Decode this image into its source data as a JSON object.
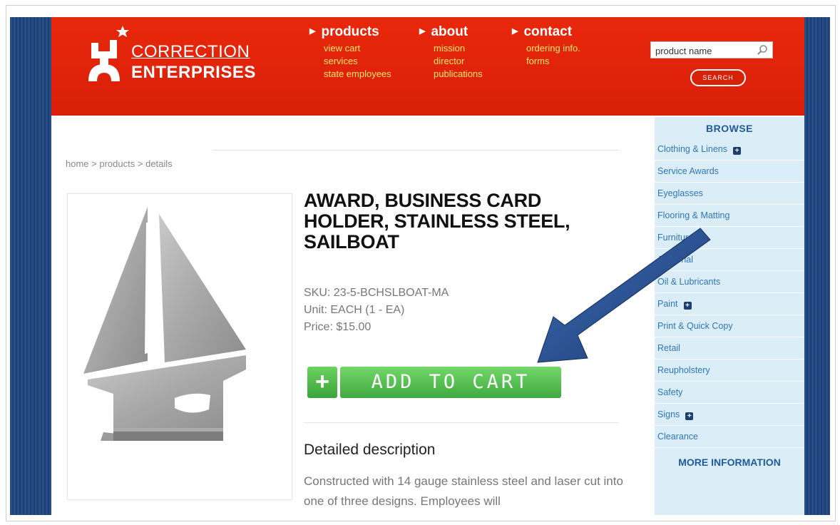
{
  "brand": {
    "line1": "CORRECTION",
    "line2": "ENTERPRISES"
  },
  "nav": [
    {
      "label": "products",
      "links": [
        "view cart",
        "services",
        "state employees"
      ]
    },
    {
      "label": "about",
      "links": [
        "mission",
        "director",
        "publications"
      ]
    },
    {
      "label": "contact",
      "links": [
        "ordering info.",
        "forms"
      ]
    }
  ],
  "search": {
    "value": "product name",
    "button_label": "SEARCH"
  },
  "breadcrumb": [
    "home",
    "products",
    "details"
  ],
  "breadcrumb_separator": ">",
  "product": {
    "title": "AWARD, BUSINESS CARD HOLDER, STAINLESS STEEL, SAILBOAT",
    "sku": "SKU: 23-5-BCHSLBOAT-MA",
    "unit": "Unit: EACH (1 - EA)",
    "price": "Price: $15.00",
    "add_to_cart": "ADD TO CART",
    "cart_plus": "+",
    "description_heading": "Detailed description",
    "description": "Constructed with 14 gauge stainless steel and laser cut into one of three designs. Employees will"
  },
  "sidebar": {
    "browse_heading": "BROWSE",
    "items": [
      {
        "label": "Clothing & Linens",
        "expandable": true
      },
      {
        "label": "Service Awards",
        "expandable": false
      },
      {
        "label": "Eyeglasses",
        "expandable": false
      },
      {
        "label": "Flooring & Matting",
        "expandable": false
      },
      {
        "label": "Furniture",
        "expandable": true
      },
      {
        "label": "Janitorial",
        "expandable": false
      },
      {
        "label": "Oil & Lubricants",
        "expandable": false
      },
      {
        "label": "Paint",
        "expandable": true
      },
      {
        "label": "Print & Quick Copy",
        "expandable": false
      },
      {
        "label": "Retail",
        "expandable": false
      },
      {
        "label": "Reupholstery",
        "expandable": false
      },
      {
        "label": "Safety",
        "expandable": false
      },
      {
        "label": "Signs",
        "expandable": true
      },
      {
        "label": "Clearance",
        "expandable": false
      }
    ],
    "more_heading": "MORE INFORMATION"
  },
  "colors": {
    "header_red": "#e8280c",
    "nav_link_yellow": "#ffe86b",
    "cart_green": "#4cb84a",
    "sidebar_bg": "#dbeef7",
    "sidebar_link": "#2f76b8",
    "arrow_blue": "#24467d"
  },
  "icons": [
    "logo-star-figure-icon",
    "magnifier-icon",
    "plus-box-icon",
    "annotation-arrow"
  ]
}
